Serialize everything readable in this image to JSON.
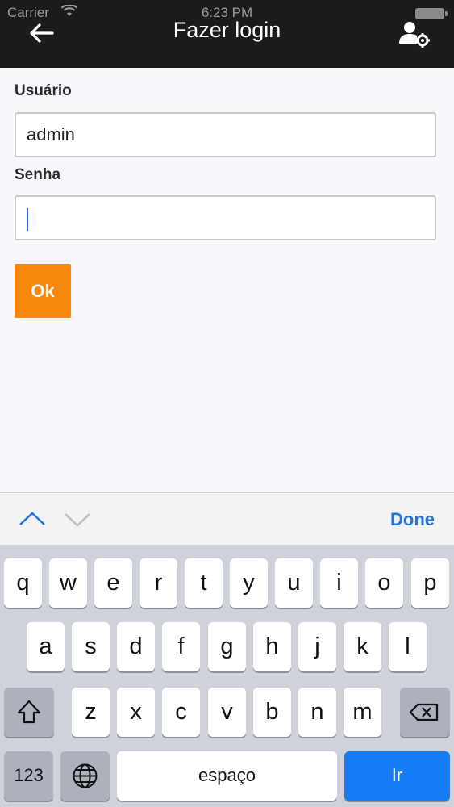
{
  "status_bar": {
    "carrier": "Carrier",
    "time": "6:23 PM"
  },
  "nav": {
    "title": "Fazer login",
    "back_icon": "arrow-left-icon",
    "settings_icon": "user-settings-icon"
  },
  "form": {
    "username_label": "Usuário",
    "username_value": "admin",
    "password_label": "Senha",
    "password_value": "",
    "ok_label": "Ok",
    "ok_color": "#f7880d"
  },
  "keyboard_toolbar": {
    "done_label": "Done",
    "prev_icon": "chevron-up-icon",
    "next_icon": "chevron-down-icon"
  },
  "keyboard": {
    "row1": [
      "q",
      "w",
      "e",
      "r",
      "t",
      "y",
      "u",
      "i",
      "o",
      "p"
    ],
    "row2": [
      "a",
      "s",
      "d",
      "f",
      "g",
      "h",
      "j",
      "k",
      "l"
    ],
    "row3": [
      "z",
      "x",
      "c",
      "v",
      "b",
      "n",
      "m"
    ],
    "numbers_label": "123",
    "space_label": "espaço",
    "go_label": "Ir",
    "accent_color": "#167cf6"
  }
}
